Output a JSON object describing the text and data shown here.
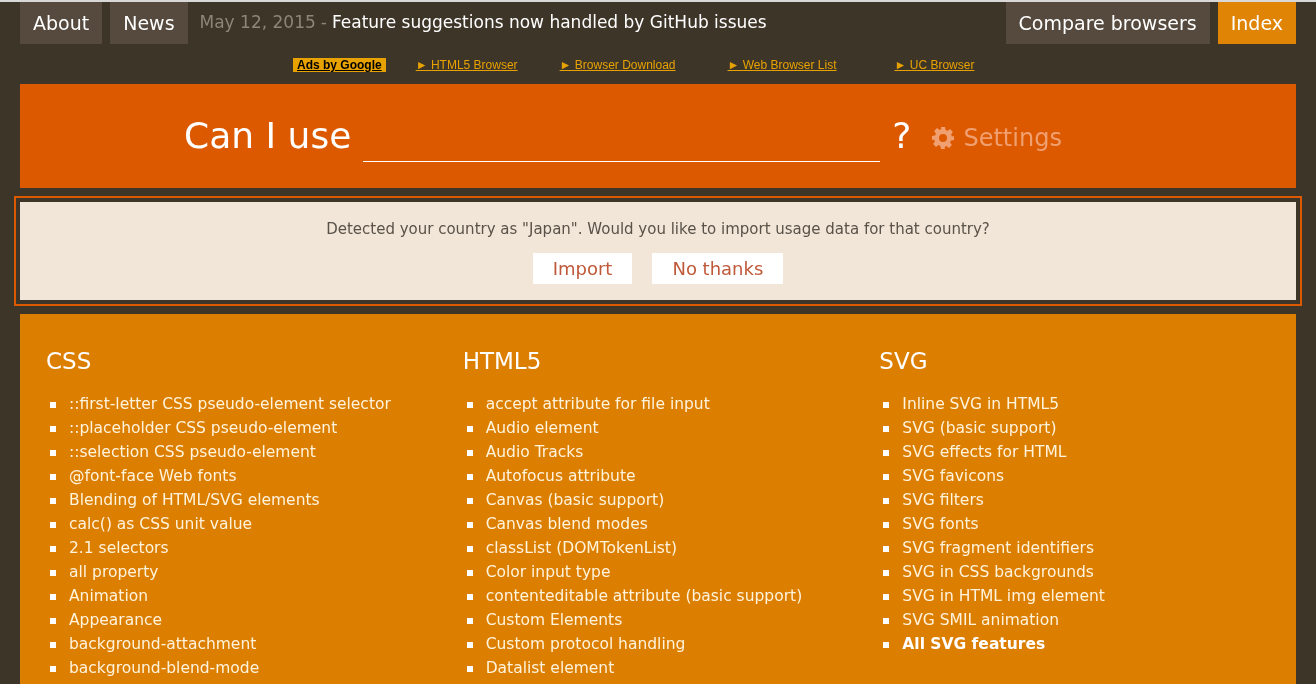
{
  "nav": {
    "left": [
      {
        "label": "About",
        "selected": false
      },
      {
        "label": "News",
        "selected": false
      }
    ],
    "news_date": "May 12, 2015",
    "news_separator": "-",
    "news_text": "Feature suggestions now handled by GitHub issues",
    "right": [
      {
        "label": "Compare browsers",
        "selected": false
      },
      {
        "label": "Index",
        "selected": true
      }
    ]
  },
  "ads": {
    "label": "Ads by Google",
    "links": [
      "► HTML5 Browser",
      "► Browser Download",
      "► Web Browser List",
      "► UC Browser"
    ]
  },
  "search": {
    "label": "Can I use",
    "suffix": "?",
    "settings": "Settings"
  },
  "notice": {
    "message": "Detected your country as \"Japan\". Would you like to import usage data for that country?",
    "buttons": [
      "Import",
      "No thanks"
    ]
  },
  "categories": [
    {
      "title": "CSS",
      "items": [
        {
          "kind": "feature",
          "text": "::first-letter CSS pseudo-element selector"
        },
        {
          "kind": "feature",
          "text": "::placeholder CSS pseudo-element"
        },
        {
          "kind": "feature",
          "text": "::selection CSS pseudo-element"
        },
        {
          "kind": "feature",
          "text": "@font-face Web fonts"
        },
        {
          "kind": "feature",
          "text": "Blending of HTML/SVG elements"
        },
        {
          "kind": "feature",
          "text": "calc() as CSS unit value"
        },
        {
          "kind": "feature",
          "text": "2.1 selectors"
        },
        {
          "kind": "feature",
          "text": "all property"
        },
        {
          "kind": "feature",
          "text": "Animation"
        },
        {
          "kind": "feature",
          "text": "Appearance"
        },
        {
          "kind": "feature",
          "text": "background-attachment"
        },
        {
          "kind": "feature",
          "text": "background-blend-mode"
        }
      ]
    },
    {
      "title": "HTML5",
      "items": [
        {
          "kind": "feature",
          "text": "accept attribute for file input"
        },
        {
          "kind": "feature",
          "text": "Audio element"
        },
        {
          "kind": "feature",
          "text": "Audio Tracks"
        },
        {
          "kind": "feature",
          "text": "Autofocus attribute"
        },
        {
          "kind": "feature",
          "text": "Canvas (basic support)"
        },
        {
          "kind": "feature",
          "text": "Canvas blend modes"
        },
        {
          "kind": "feature",
          "text": "classList (DOMTokenList)"
        },
        {
          "kind": "feature",
          "text": "Color input type"
        },
        {
          "kind": "feature",
          "text": "contenteditable attribute (basic support)"
        },
        {
          "kind": "feature",
          "text": "Custom Elements"
        },
        {
          "kind": "feature",
          "text": "Custom protocol handling"
        },
        {
          "kind": "feature",
          "text": "Datalist element"
        }
      ]
    },
    {
      "title": "SVG",
      "items": [
        {
          "kind": "feature",
          "text": "Inline SVG in HTML5"
        },
        {
          "kind": "feature",
          "text": "SVG (basic support)"
        },
        {
          "kind": "feature",
          "text": "SVG effects for HTML"
        },
        {
          "kind": "feature",
          "text": "SVG favicons"
        },
        {
          "kind": "feature",
          "text": "SVG filters"
        },
        {
          "kind": "feature",
          "text": "SVG fonts"
        },
        {
          "kind": "feature",
          "text": "SVG fragment identifiers"
        },
        {
          "kind": "feature",
          "text": "SVG in CSS backgrounds"
        },
        {
          "kind": "feature",
          "text": "SVG in HTML img element"
        },
        {
          "kind": "feature",
          "text": "SVG SMIL animation"
        },
        {
          "kind": "all",
          "text": "All SVG features"
        }
      ]
    }
  ]
}
